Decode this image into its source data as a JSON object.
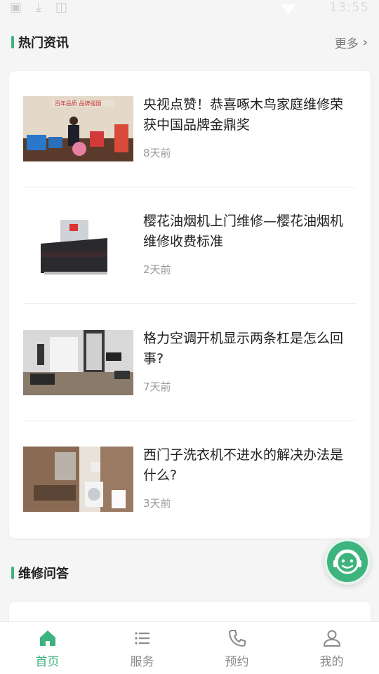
{
  "status_bar": {
    "time": "13:55",
    "icons": [
      "gallery-icon",
      "download-icon",
      "image-icon",
      "signal-icon",
      "battery-icon"
    ]
  },
  "hot_news": {
    "title": "热门资讯",
    "more_label": "更多",
    "items": [
      {
        "title": "央视点赞！恭喜啄木鸟家庭维修荣获中国品牌金鼎奖",
        "time": "8天前",
        "image": "award-ceremony-photo"
      },
      {
        "title": "樱花油烟机上门维修—樱花油烟机维修收费标准",
        "time": "2天前",
        "image": "range-hood-photo"
      },
      {
        "title": "格力空调开机显示两条杠是怎么回事?",
        "time": "7天前",
        "image": "living-room-photo"
      },
      {
        "title": "西门子洗衣机不进水的解决办法是什么?",
        "time": "3天前",
        "image": "bathroom-washer-photo"
      }
    ]
  },
  "repair_qa": {
    "title": "维修问答"
  },
  "support_button": {
    "icon": "customer-service-icon"
  },
  "tabbar": {
    "tabs": [
      {
        "label": "首页",
        "icon": "home-icon",
        "active": true
      },
      {
        "label": "服务",
        "icon": "list-icon",
        "active": false
      },
      {
        "label": "预约",
        "icon": "phone-icon",
        "active": false
      },
      {
        "label": "我的",
        "icon": "user-icon",
        "active": false
      }
    ]
  },
  "colors": {
    "accent": "#3db37e",
    "text": "#222222",
    "muted": "#9a9a9a",
    "background": "#f5f5f5"
  }
}
